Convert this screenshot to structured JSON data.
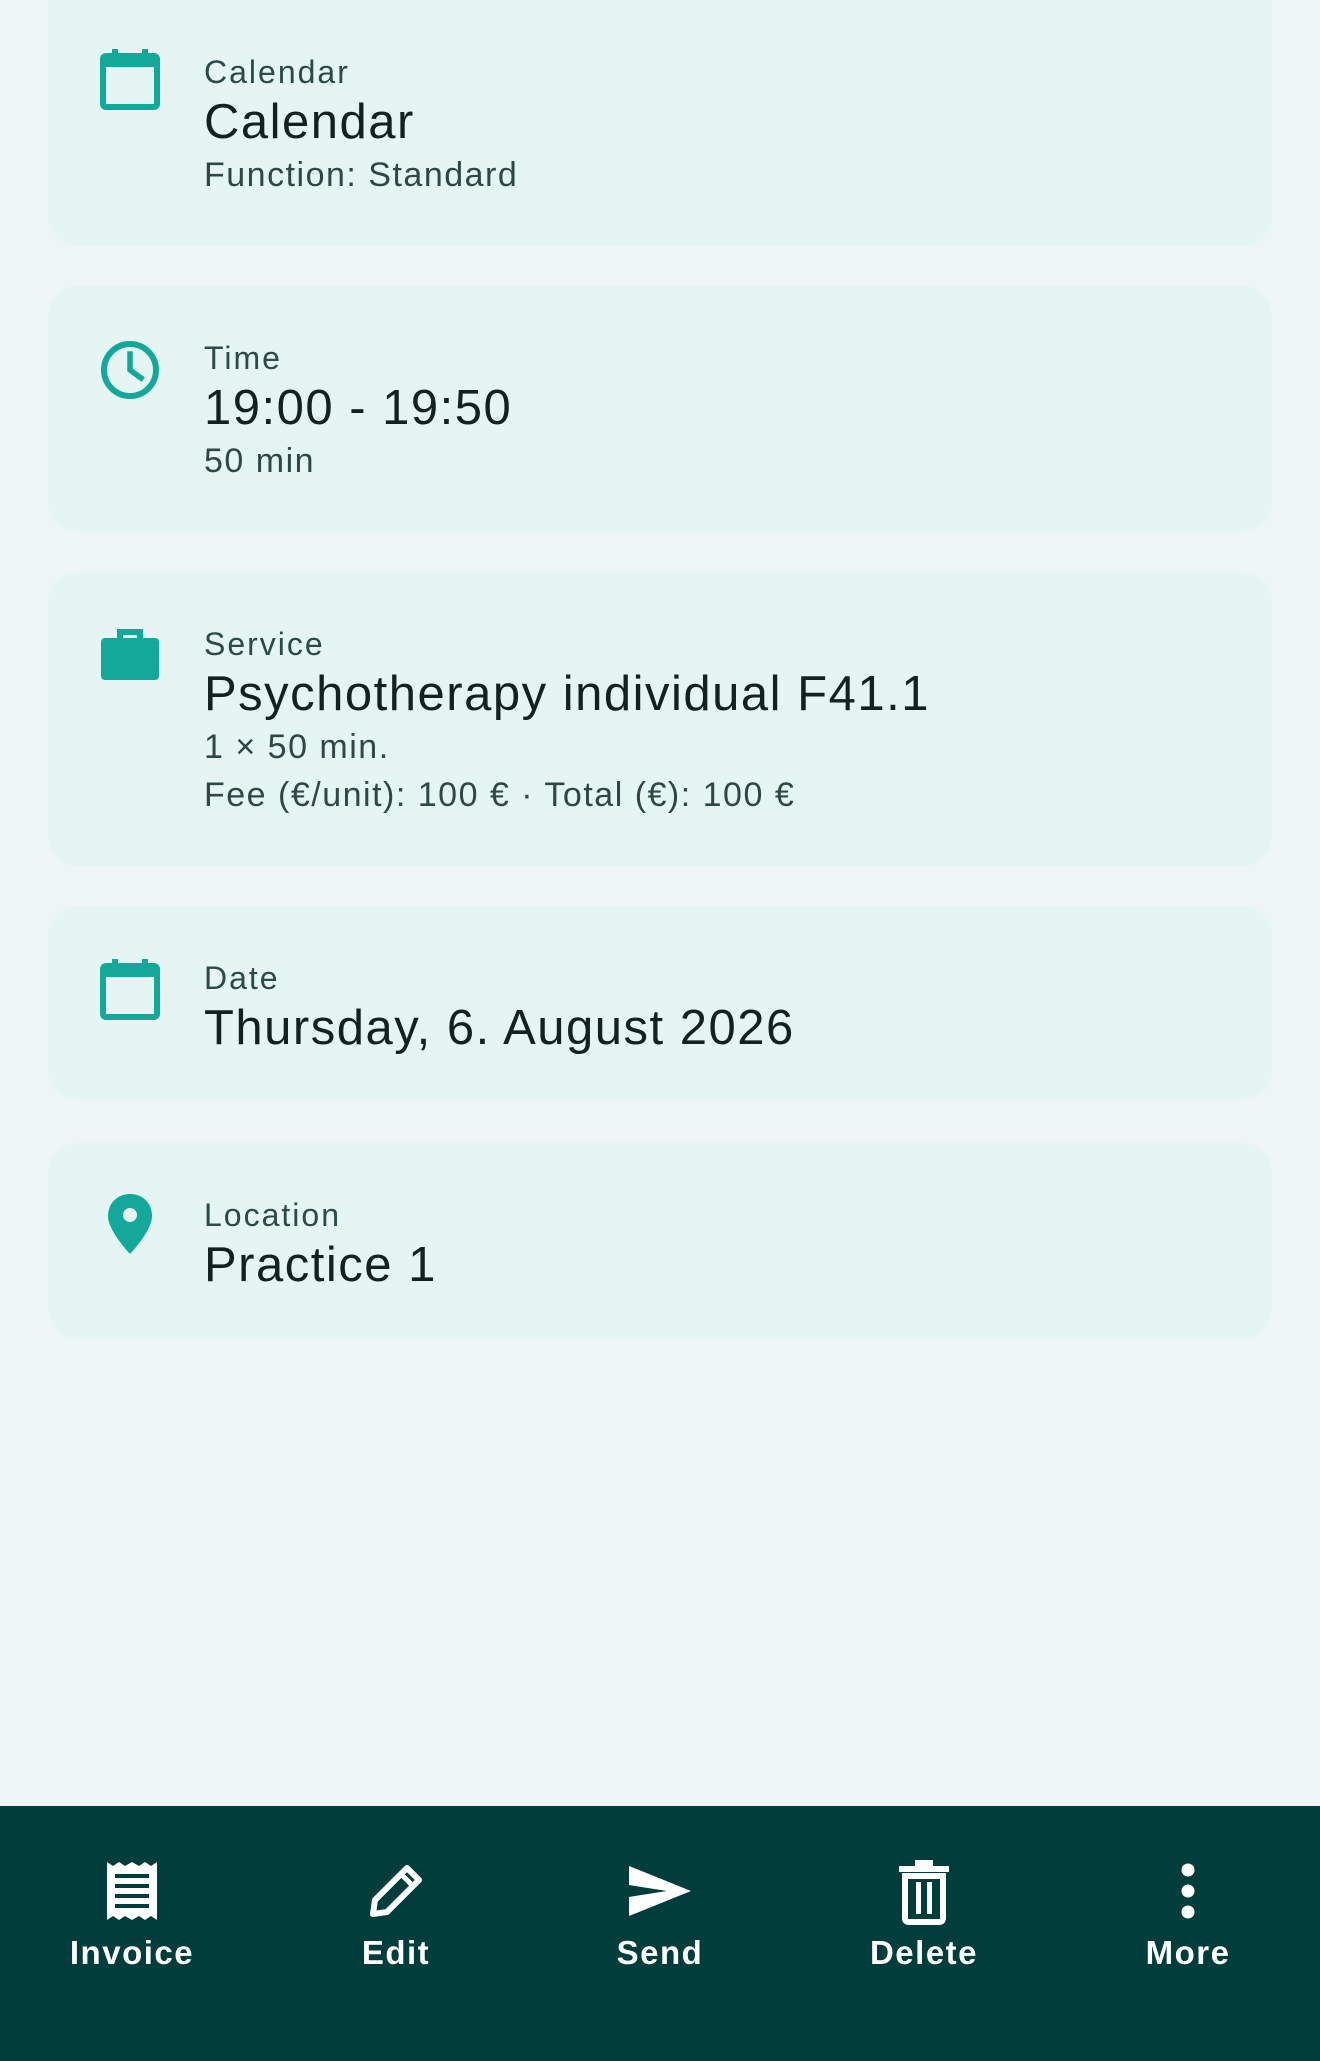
{
  "colors": {
    "background": "#eef6f5",
    "card": "#e5f5f3",
    "accent": "#13a89a",
    "bottom_bar": "#013d3a",
    "bottom_bar_text": "#ffffff"
  },
  "cards": {
    "calendar": {
      "icon": "calendar-icon",
      "label": "Calendar",
      "title": "Calendar",
      "subtitle": "Function: Standard"
    },
    "time": {
      "icon": "clock-icon",
      "label": "Time",
      "title": "19:00 - 19:50",
      "subtitle": "50 min"
    },
    "service": {
      "icon": "briefcase-icon",
      "label": "Service",
      "title": "Psychotherapy individual F41.1",
      "quantity": "1 × 50 min.",
      "fee": "Fee (€/unit): 100 € · Total (€): 100 €"
    },
    "date": {
      "icon": "calendar-icon",
      "label": "Date",
      "title": "Thursday, 6. August  2026"
    },
    "location": {
      "icon": "location-pin-icon",
      "label": "Location",
      "title": "Practice 1"
    }
  },
  "bottom_bar": {
    "invoice": {
      "label": "Invoice",
      "icon": "receipt-icon"
    },
    "edit": {
      "label": "Edit",
      "icon": "pencil-icon"
    },
    "send": {
      "label": "Send",
      "icon": "send-icon"
    },
    "delete": {
      "label": "Delete",
      "icon": "trash-icon"
    },
    "more": {
      "label": "More",
      "icon": "more-vert-icon"
    }
  }
}
